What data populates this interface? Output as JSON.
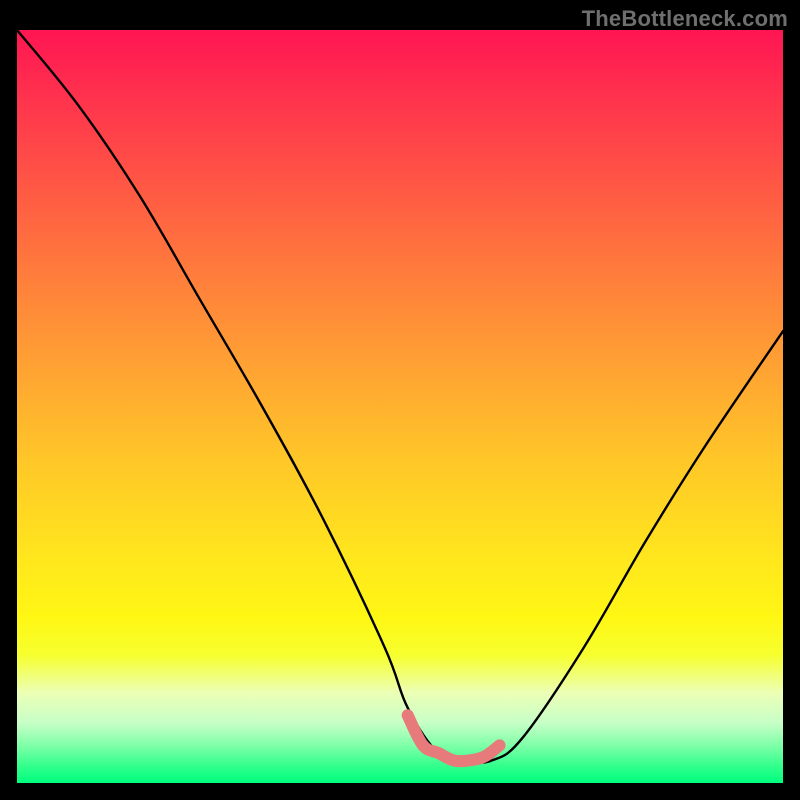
{
  "watermark": "TheBottleneck.com",
  "chart_data": {
    "type": "line",
    "title": "",
    "xlabel": "",
    "ylabel": "",
    "xlim": [
      0,
      100
    ],
    "ylim": [
      0,
      100
    ],
    "series": [
      {
        "name": "black-curve",
        "color": "#000000",
        "x": [
          0,
          8,
          16,
          24,
          32,
          40,
          48,
          51,
          55,
          59,
          62,
          66,
          74,
          82,
          90,
          100
        ],
        "values": [
          100,
          90,
          78,
          64,
          50,
          35,
          18,
          10,
          4,
          3,
          3,
          6,
          18,
          32,
          45,
          60
        ]
      },
      {
        "name": "pink-segment",
        "color": "#e77a7a",
        "x": [
          51,
          53,
          55,
          57,
          59,
          61,
          63
        ],
        "values": [
          9,
          5,
          4,
          3,
          3,
          3.5,
          5
        ]
      }
    ],
    "gradient_stops": [
      {
        "pos": 0.0,
        "color": "#ff1552"
      },
      {
        "pos": 0.08,
        "color": "#ff2f4e"
      },
      {
        "pos": 0.2,
        "color": "#ff5545"
      },
      {
        "pos": 0.32,
        "color": "#ff7b3c"
      },
      {
        "pos": 0.46,
        "color": "#ffa632"
      },
      {
        "pos": 0.58,
        "color": "#ffc927"
      },
      {
        "pos": 0.7,
        "color": "#ffe61d"
      },
      {
        "pos": 0.78,
        "color": "#fff714"
      },
      {
        "pos": 0.83,
        "color": "#f6ff2e"
      },
      {
        "pos": 0.88,
        "color": "#ecffb5"
      },
      {
        "pos": 0.92,
        "color": "#c7ffc7"
      },
      {
        "pos": 0.95,
        "color": "#7fffa8"
      },
      {
        "pos": 0.98,
        "color": "#2bff8a"
      },
      {
        "pos": 1.0,
        "color": "#00ff7e"
      }
    ]
  }
}
